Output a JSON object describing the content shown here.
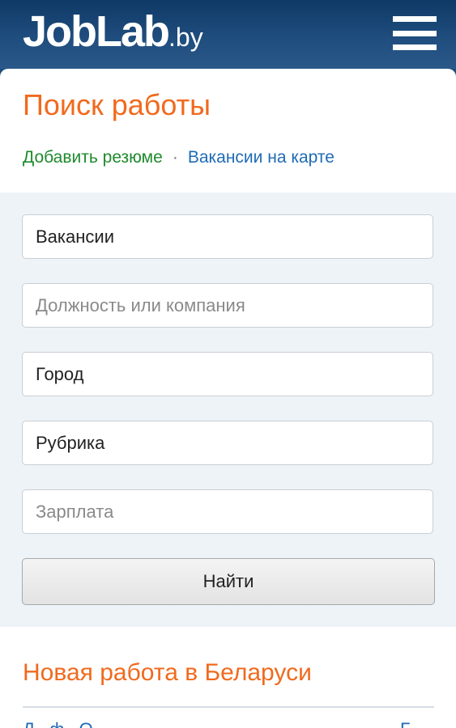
{
  "header": {
    "logo_main": "JobLab",
    "logo_tld": ".by",
    "menu_icon": "hamburger-menu-icon"
  },
  "page": {
    "title": "Поиск работы",
    "link_add_resume": "Добавить резюме",
    "link_separator": "·",
    "link_vacancies_map": "Вакансии на карте"
  },
  "search": {
    "type_value": "Вакансии",
    "position_placeholder": "Должность или компания",
    "city_value": "Город",
    "category_value": "Рубрика",
    "salary_placeholder": "Зарплата",
    "submit_label": "Найти"
  },
  "news": {
    "title": "Новая работа в Беларуси",
    "peek_left": "Д...ф...О...",
    "peek_right": "Б..."
  },
  "colors": {
    "header_bg": "#1f4d7e",
    "accent_orange": "#f06a1e",
    "link_green": "#1f8a2e",
    "link_blue": "#1f6bb5",
    "panel_bg": "#eef3f8"
  }
}
